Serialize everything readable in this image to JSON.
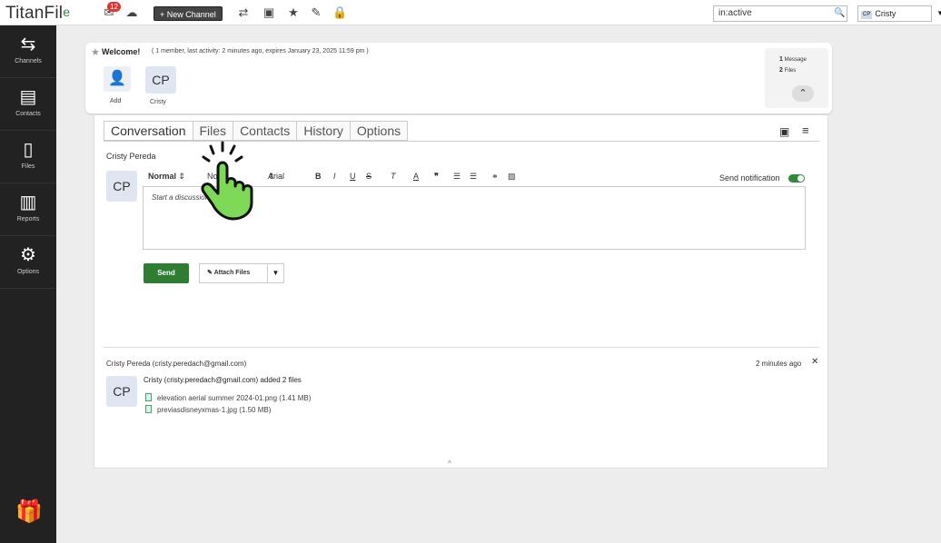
{
  "topbar": {
    "logo_text": "TitanFil",
    "logo_suffix": "e",
    "notif_count": "12",
    "new_channel_label": "+ New Channel",
    "search_value": "in:active",
    "user_avatar": "CP",
    "user_name": "Cristy"
  },
  "sidebar": {
    "items": [
      {
        "label": "Channels",
        "icon": "arrows-icon"
      },
      {
        "label": "Contacts",
        "icon": "contacts-icon"
      },
      {
        "label": "Files",
        "icon": "file-icon"
      },
      {
        "label": "Reports",
        "icon": "reports-icon"
      },
      {
        "label": "Options",
        "icon": "gear-icon"
      }
    ]
  },
  "channel": {
    "title": "Welcome!",
    "meta": "( 1 member, last activity: 2 minutes ago, expires January 23, 2025 11:59 pm )",
    "add_label": "Add",
    "member_initials": "CP",
    "member_name": "Cristy",
    "stats_messages_count": "1",
    "stats_messages_label": "Message",
    "stats_files_count": "2",
    "stats_files_label": "Files"
  },
  "tabs": [
    "Conversation",
    "Files",
    "Contacts",
    "History",
    "Options"
  ],
  "composer": {
    "author": "Cristy Pereda",
    "avatar": "CP",
    "format_style": "Normal",
    "font_size": "No",
    "font_family": "Arial",
    "placeholder": "Start a discussion...",
    "notify_label": "Send notification",
    "send_label": "Send",
    "attach_label": "Attach Files"
  },
  "entry": {
    "author": "Cristy Pereda (cristy.peredach@gmail.com)",
    "time": "2 minutes ago",
    "avatar": "CP",
    "action": "Cristy (cristy.peredach@gmail.com) added 2 files",
    "files": [
      "elevation aerial summer 2024-01.png (1.41 MB)",
      "previasdisneyxmas-1.jpg (1.50 MB)"
    ]
  },
  "colors": {
    "accent_green": "#2e7d32",
    "sidebar_bg": "#222222",
    "pointer_green": "#7ed957"
  }
}
